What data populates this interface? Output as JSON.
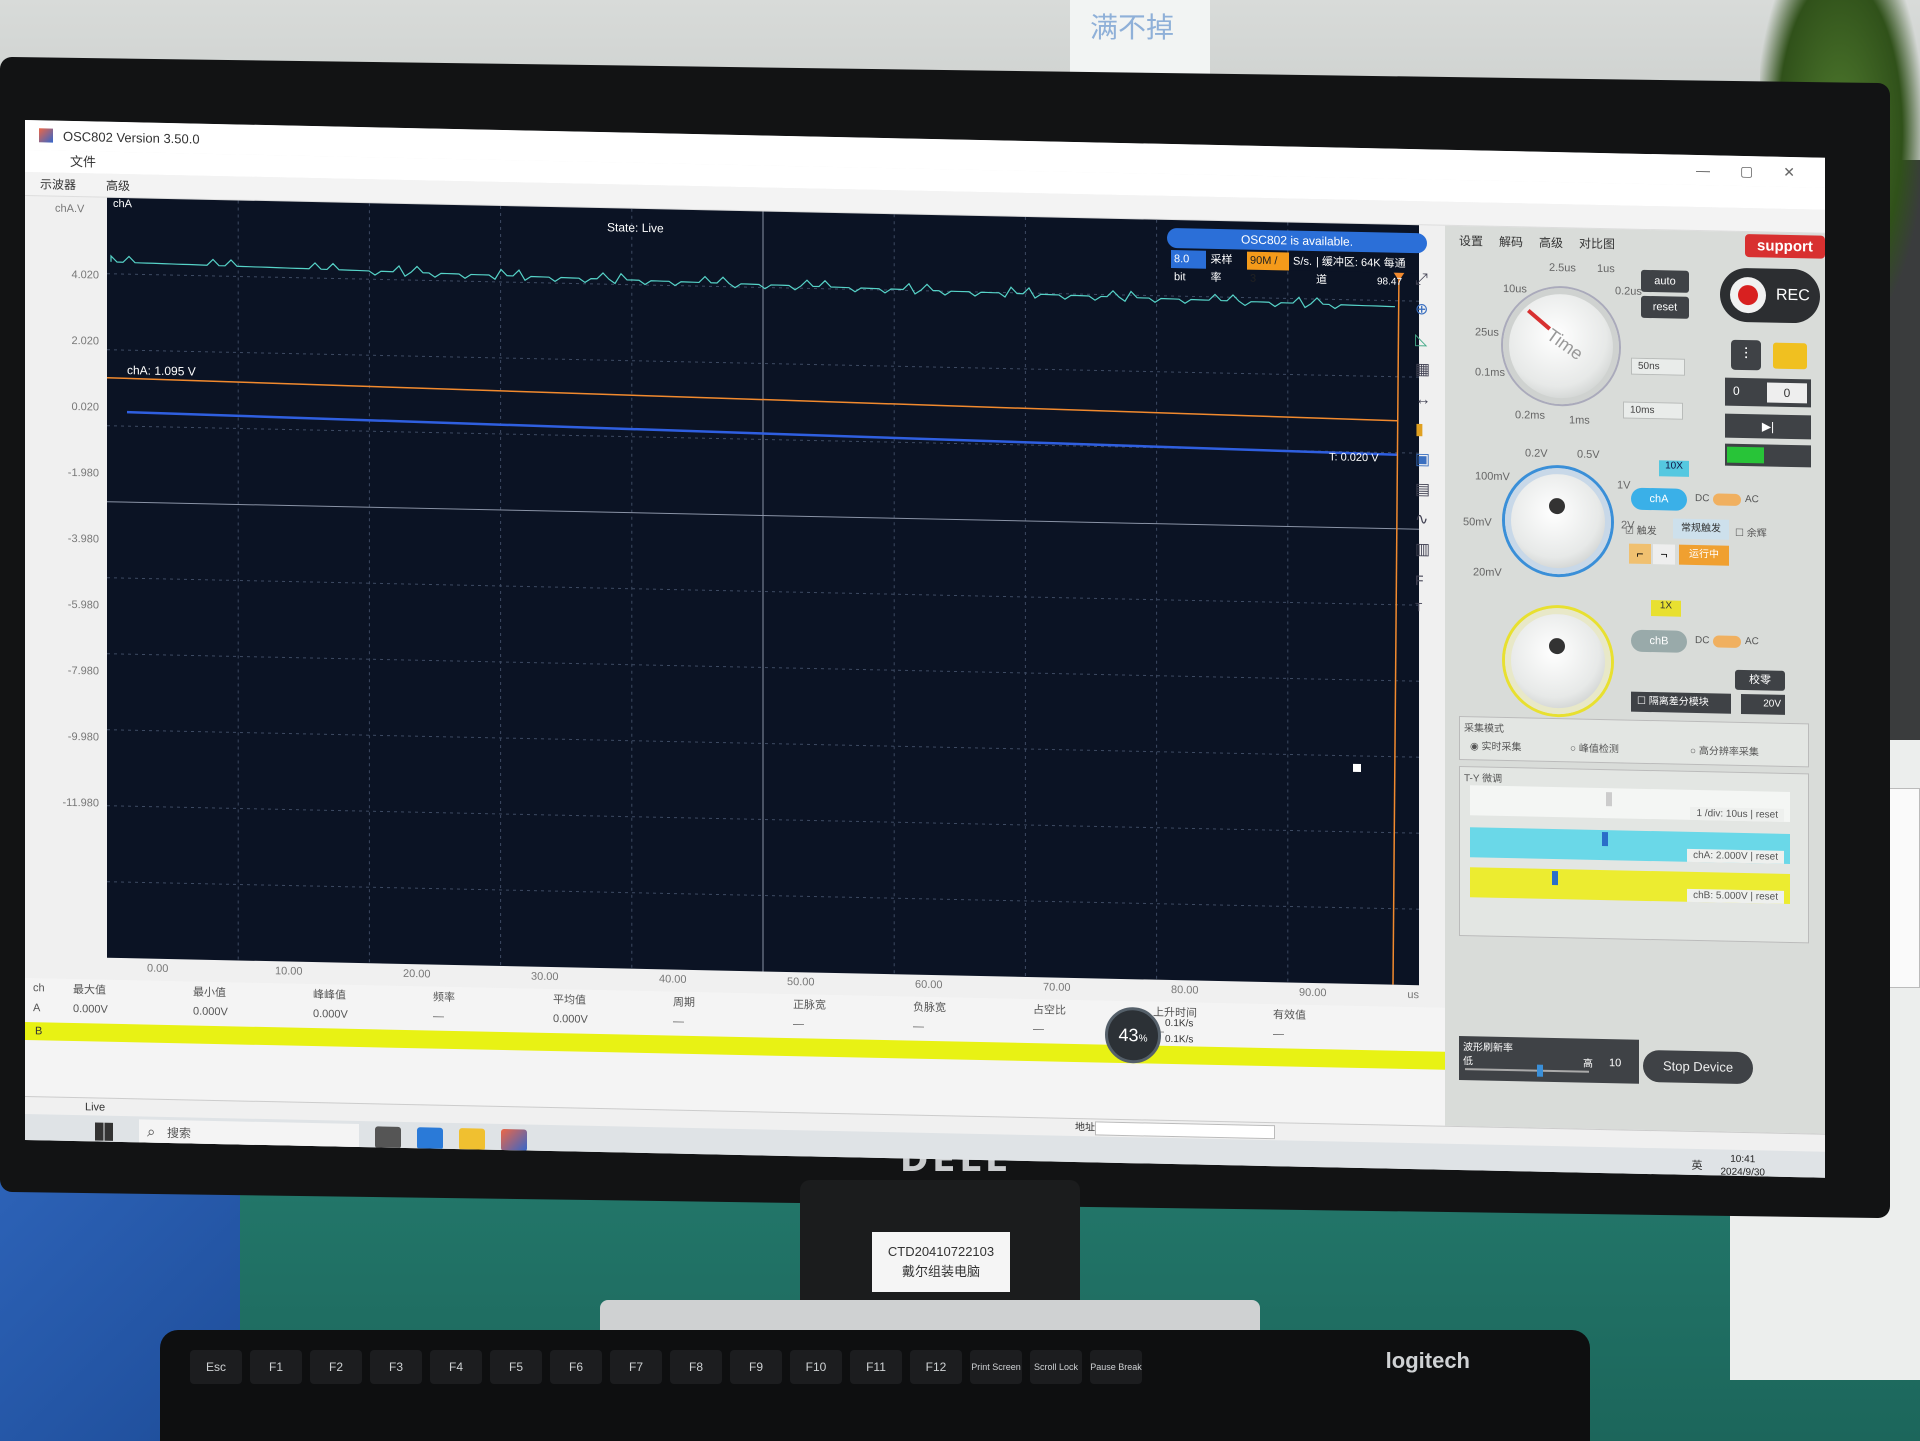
{
  "window": {
    "app_title": "OSC802  Version 3.50.0",
    "menu_file": "文件",
    "tabs": [
      "示波器",
      "高级"
    ],
    "controls": [
      "—",
      "▢",
      "✕"
    ]
  },
  "scope": {
    "channel_tag": "chA",
    "y_unit": "chA.V",
    "y_ticks": [
      "4.020",
      "2.020",
      "0.020",
      "-1.980",
      "-3.980",
      "-5.980",
      "-7.980",
      "-9.980",
      "-11.980"
    ],
    "x_ticks": [
      "0.00",
      "10.00",
      "20.00",
      "30.00",
      "40.00",
      "50.00",
      "60.00",
      "70.00",
      "80.00",
      "90.00"
    ],
    "x_unit": "us",
    "state": "State: Live",
    "available": "OSC802  is available.",
    "bit_depth": "8.0 bit",
    "sample_rate_label": "采样率",
    "sample_rate_value": "90M / 3",
    "sample_rate_suffix": "S/s.",
    "buffer": "| 缓冲区: 64K 每通道",
    "corner_value": "98.47",
    "cha_level": "chA: 1.095 V",
    "trigger_level": "T: 0.020 V",
    "colors": {
      "background": "#0b1324",
      "grid": "#3d4a62",
      "cha_signal": "#56d3c8",
      "trigger_line": "#f28a2e",
      "chb_line": "#2f5fe0"
    }
  },
  "measurements": {
    "headers": [
      "ch",
      "最大值",
      "最小值",
      "峰峰值",
      "频率",
      "平均值",
      "周期",
      "正脉宽",
      "负脉宽",
      "占空比",
      "上升时间",
      "有效值"
    ],
    "row_a": [
      "A",
      "0.000V",
      "0.000V",
      "0.000V",
      "—",
      "0.000V",
      "—",
      "—",
      "—",
      "—",
      "—",
      "—"
    ],
    "row_b_label": "B",
    "gauge_percent": "43",
    "gauge_unit": "%",
    "rate_up": "0.1K/s",
    "rate_down": "0.1K/s"
  },
  "panel": {
    "tabs": [
      "设置",
      "解码",
      "高级",
      "对比图"
    ],
    "support": "support",
    "rec": "REC",
    "btn_auto": "auto",
    "btn_reset": "reset",
    "time_knob_label": "Time",
    "time_labels": [
      "2.5us",
      "1us",
      "0.2us",
      "10us",
      "25us",
      "0.1ms",
      "0.2ms",
      "1ms"
    ],
    "time_select_1": "50ns",
    "time_select_2": "10ms",
    "counter_left": "0",
    "counter_right": "0",
    "volt_labels": [
      "0.2V",
      "0.5V",
      "1V",
      "2V",
      "100mV",
      "50mV",
      "20mV"
    ],
    "cha_probe": "10X",
    "cha_toggle": "chA",
    "cha_coupling_dc": "DC",
    "cha_coupling_ac": "AC",
    "trigger_check": "触发",
    "trigger_mode": "常规触发",
    "trigger_running": "运行中",
    "single_label": "余辉",
    "chb_probe": "1X",
    "chb_toggle": "chB",
    "chb_coupling_dc": "DC",
    "chb_coupling_ac": "AC",
    "calibrate": "校零",
    "isolation_module": "隔离差分模块",
    "isolation_voltage": "20V",
    "acq_mode_title": "采集模式",
    "acq_modes": [
      "实时采集",
      "峰值检测",
      "高分辨率采集"
    ],
    "ty_title": "T-Y 微调",
    "band_labels": [
      "1 /div: 10us | reset",
      "chA: 2.000V | reset",
      "chB: 5.000V | reset"
    ],
    "refresh_title": "波形刷新率",
    "refresh_low": "低",
    "refresh_high": "高",
    "refresh_value": "10",
    "stop_device": "Stop Device"
  },
  "statusbar": {
    "mode": "Live",
    "address_label": "地址"
  },
  "taskbar": {
    "search_placeholder": "搜索",
    "ime": "英",
    "time": "10:41",
    "date": "2024/9/30"
  },
  "environment": {
    "monitor_brand": "DELL",
    "stand_label_line1": "CTD20410722103",
    "stand_label_line2": "戴尔组装电脑",
    "keyboard_brand": "logitech",
    "keys": [
      "Esc",
      "F1",
      "F2",
      "F3",
      "F4",
      "F5",
      "F6",
      "F7",
      "F8",
      "F9",
      "F10",
      "F11",
      "F12",
      "Print Screen",
      "Scroll Lock",
      "Pause Break"
    ],
    "wall_note": "满不掉"
  }
}
